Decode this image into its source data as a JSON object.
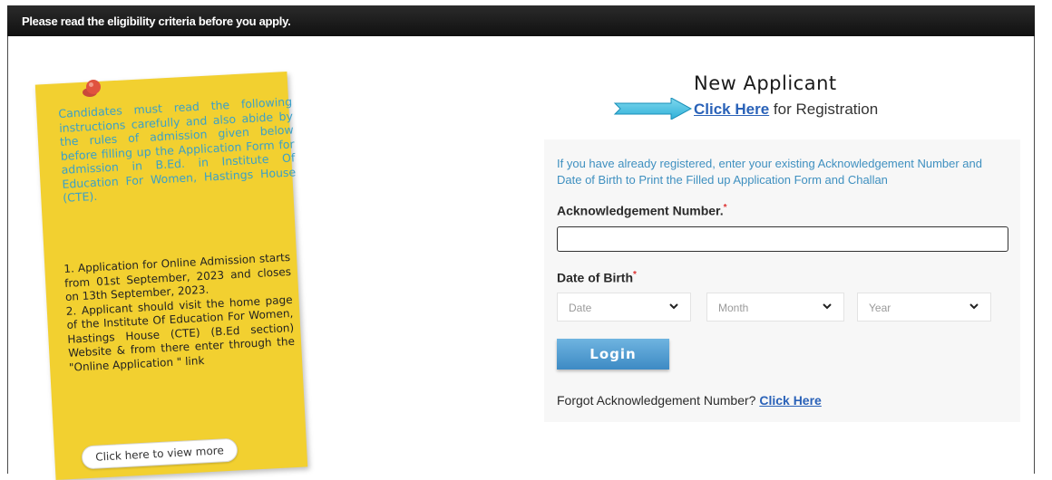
{
  "topbar": {
    "notice": "Please read the eligibility criteria before you apply."
  },
  "notice_board": {
    "intro": "Candidates must read the following instructions carefully and also abide by the rules of admission given below before filling up the Application Form for admission in B.Ed. in Institute Of Education For Women, Hastings House (CTE).",
    "items": [
      "1. Application for Online Admission starts from 01st September, 2023 and closes on 13th September, 2023.",
      "2. Applicant should visit the home page of the Institute Of Education For Women, Hastings House (CTE) (B.Ed section) Website & from there enter through the \"Online Application \" link"
    ],
    "view_more_label": "Click here to view more",
    "pin_icon": "pushpin-icon"
  },
  "new_applicant": {
    "heading": "New Applicant",
    "link_label": "Click Here",
    "suffix": "for Registration",
    "arrow_icon": "right-arrow-icon"
  },
  "login_form": {
    "info": "If you have already registered, enter your existing Acknowledgement Number and Date of Birth to Print the Filled up Application Form and Challan",
    "ack_label": "Acknowledgement Number.",
    "ack_value": "",
    "dob_label": "Date of Birth",
    "required_mark": "*",
    "date_placeholder": "Date",
    "month_placeholder": "Month",
    "year_placeholder": "Year",
    "login_label": "Login",
    "forgot_text": "Forgot Acknowledgement Number?",
    "forgot_link": "Click Here"
  },
  "colors": {
    "note_yellow": "#f2d030",
    "link_blue": "#2a62b8",
    "info_blue": "#3f90c0",
    "button_blue": "#4a95cc"
  }
}
